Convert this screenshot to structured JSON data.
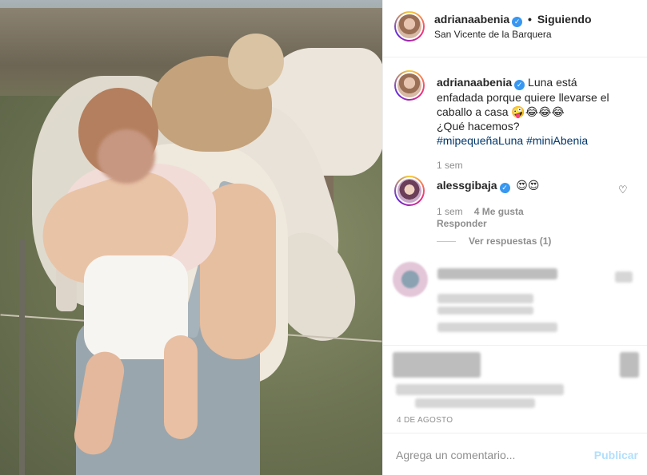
{
  "post": {
    "author": "adrianaabenia",
    "follow_status": "Siguiendo",
    "location": "San Vicente de la Barquera",
    "caption_line1": "Luna está",
    "caption_line2": "enfadada porque quiere llevarse el",
    "caption_line3": "caballo a casa 🤪😂😂😂",
    "caption_line4": "¿Qué hacemos?",
    "hashtags": "#mipequeñaLuna #miniAbenia",
    "caption_time": "1 sem",
    "date": "4 DE AGOSTO"
  },
  "comments": [
    {
      "username": "alessgibaja",
      "text": "😍😍",
      "time": "1 sem",
      "likes": "4 Me gusta",
      "reply_label": "Responder",
      "view_replies": "Ver respuestas (1)"
    }
  ],
  "add_comment": {
    "placeholder": "Agrega un comentario...",
    "publish_label": "Publicar"
  },
  "icons": {
    "verified": "verified-badge-icon",
    "heart": "heart-icon"
  },
  "colors": {
    "verified": "#3897f0",
    "hashtag": "#00376b",
    "publish_disabled": "#b2dffc"
  }
}
